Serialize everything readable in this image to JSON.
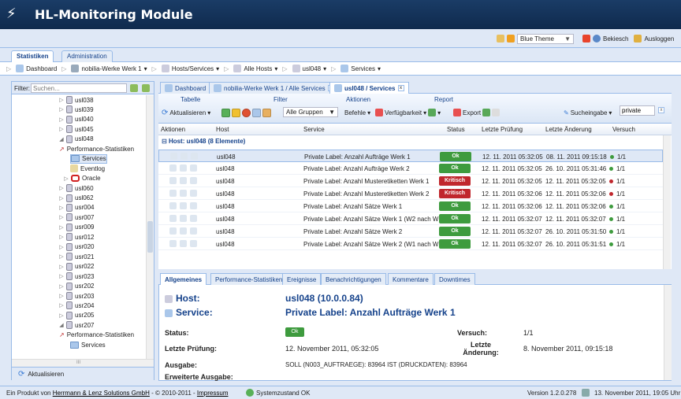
{
  "header": {
    "title": "HL-Monitoring Module"
  },
  "topbar": {
    "theme_value": "Blue Theme",
    "bekiesch": "Bekiesch",
    "logout": "Ausloggen"
  },
  "main_tabs": [
    "Statistiken",
    "Administration"
  ],
  "breadcrumbs": [
    "Dashboard",
    "nobilia-Werke Werk 1",
    "Hosts/Services",
    "Alle Hosts",
    "usl048",
    "Services"
  ],
  "left": {
    "filter_label": "Filter:",
    "filter_placeholder": "Suchen...",
    "refresh": "Aktualisieren",
    "tree": [
      {
        "label": "usl038",
        "type": "host",
        "expanded": false
      },
      {
        "label": "usl039",
        "type": "host",
        "expanded": false
      },
      {
        "label": "usl040",
        "type": "host",
        "expanded": false
      },
      {
        "label": "usl045",
        "type": "host",
        "expanded": false
      },
      {
        "label": "usl048",
        "type": "host",
        "expanded": true
      },
      {
        "label": "Performance-Statistiken",
        "type": "perf"
      },
      {
        "label": "Services",
        "type": "services",
        "selected": true
      },
      {
        "label": "Eventlog",
        "type": "eventlog"
      },
      {
        "label": "Oracle",
        "type": "oracle"
      },
      {
        "label": "usl060",
        "type": "host",
        "expanded": false
      },
      {
        "label": "usl062",
        "type": "host",
        "expanded": false
      },
      {
        "label": "usr004",
        "type": "host",
        "expanded": false
      },
      {
        "label": "usr007",
        "type": "host",
        "expanded": false
      },
      {
        "label": "usr009",
        "type": "host",
        "expanded": false
      },
      {
        "label": "usr012",
        "type": "host",
        "expanded": false
      },
      {
        "label": "usr020",
        "type": "host",
        "expanded": false
      },
      {
        "label": "usr021",
        "type": "host",
        "expanded": false
      },
      {
        "label": "usr022",
        "type": "host",
        "expanded": false
      },
      {
        "label": "usr023",
        "type": "host",
        "expanded": false
      },
      {
        "label": "usr202",
        "type": "host",
        "expanded": false
      },
      {
        "label": "usr203",
        "type": "host",
        "expanded": false
      },
      {
        "label": "usr204",
        "type": "host",
        "expanded": false
      },
      {
        "label": "usr205",
        "type": "host",
        "expanded": false
      },
      {
        "label": "usr207",
        "type": "host",
        "expanded": true
      },
      {
        "label": "Performance-Statistiken",
        "type": "perf"
      },
      {
        "label": "Services",
        "type": "services"
      }
    ],
    "hscroll_label": "III"
  },
  "right_tabs": [
    "Dashboard",
    "nobilia-Werke Werk 1 / Alle Services",
    "usl048 / Services"
  ],
  "toolbar": {
    "groups": {
      "tabelle": "Tabelle",
      "filter": "Filter",
      "aktionen": "Aktionen",
      "report": "Report"
    },
    "refresh": "Aktualisieren",
    "groups_select": "Alle Gruppen",
    "befehle": "Befehle",
    "verfuegbarkeit": "Verfügbarkeit",
    "export": "Export",
    "search_label": "Sucheingabe",
    "search_value": "private"
  },
  "grid": {
    "headers": [
      "Aktionen",
      "Host",
      "Service",
      "Status",
      "Letzte Prüfung",
      "Letzte Änderung",
      "Versuch"
    ],
    "group_label": "Host: usl048 (8 Elemente)",
    "rows": [
      {
        "host": "usl048",
        "service": "Private Label: Anzahl Aufträge Werk 1",
        "status": "Ok",
        "last_check": "12. 11. 2011 05:32:05",
        "last_change": "08. 11. 2011 09:15:18",
        "attempt": "1/1"
      },
      {
        "host": "usl048",
        "service": "Private Label: Anzahl Aufträge Werk 2",
        "status": "Ok",
        "last_check": "12. 11. 2011 05:32:05",
        "last_change": "26. 10. 2011 05:31:46",
        "attempt": "1/1"
      },
      {
        "host": "usl048",
        "service": "Private Label: Anzahl Musteretiketten Werk 1",
        "status": "Kritisch",
        "last_check": "12. 11. 2011 05:32:05",
        "last_change": "12. 11. 2011 05:32:05",
        "attempt": "1/1"
      },
      {
        "host": "usl048",
        "service": "Private Label: Anzahl Musteretiketten Werk 2",
        "status": "Kritisch",
        "last_check": "12. 11. 2011 05:32:06",
        "last_change": "12. 11. 2011 05:32:06",
        "attempt": "1/1"
      },
      {
        "host": "usl048",
        "service": "Private Label: Anzahl Sätze Werk 1",
        "status": "Ok",
        "last_check": "12. 11. 2011 05:32:06",
        "last_change": "12. 11. 2011 05:32:06",
        "attempt": "1/1"
      },
      {
        "host": "usl048",
        "service": "Private Label: Anzahl Sätze Werk 1 (W2 nach W1)",
        "status": "Ok",
        "last_check": "12. 11. 2011 05:32:07",
        "last_change": "12. 11. 2011 05:32:07",
        "attempt": "1/1"
      },
      {
        "host": "usl048",
        "service": "Private Label: Anzahl Sätze Werk 2",
        "status": "Ok",
        "last_check": "12. 11. 2011 05:32:07",
        "last_change": "26. 10. 2011 05:31:50",
        "attempt": "1/1"
      },
      {
        "host": "usl048",
        "service": "Private Label: Anzahl Sätze Werk 2 (W1 nach W2)",
        "status": "Ok",
        "last_check": "12. 11. 2011 05:32:07",
        "last_change": "26. 10. 2011 05:31:51",
        "attempt": "1/1"
      }
    ]
  },
  "detail_tabs": [
    "Allgemeines",
    "Performance-Statistiken",
    "Ereignisse",
    "Benachrichtigungen",
    "Kommentare",
    "Downtimes"
  ],
  "detail": {
    "host_label": "Host:",
    "host_value": "usl048 (10.0.0.84)",
    "service_label": "Service:",
    "service_value": "Private Label: Anzahl Aufträge Werk 1",
    "status_label": "Status:",
    "status_value": "Ok",
    "attempt_label": "Versuch:",
    "attempt_value": "1/1",
    "last_check_label": "Letzte Prüfung:",
    "last_check_value": "12. November 2011, 05:32:05",
    "last_change_label": "Letzte Änderung:",
    "last_change_value": "8. November 2011, 09:15:18",
    "output_label": "Ausgabe:",
    "output_value": "SOLL (N003_AUFTRAEGE): 83964 IST (DRUCKDATEN): 83964",
    "ext_output_label": "Erweiterte Ausgabe:"
  },
  "footer": {
    "prefix": "Ein Produkt von",
    "company": "Herrmann & Lenz Solutions GmbH",
    "copyright": "- © 2010-2011 -",
    "impressum": "Impressum",
    "system_status": "Systemzustand OK",
    "version": "Version 1.2.0.278",
    "datetime": "13. November 2011, 19:05 Uhr"
  },
  "colors": {
    "ok": "#3e9b3e",
    "critical": "#c0272d",
    "header_bg": "#1a3c66",
    "panel_border": "#99bbe8"
  }
}
